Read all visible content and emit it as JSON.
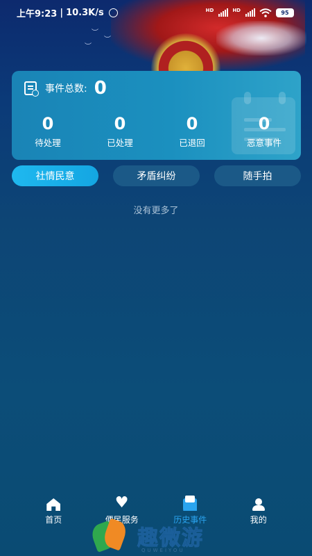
{
  "status_bar": {
    "time": "上午9:23",
    "separator": "|",
    "speed": "10.3K/s",
    "hd1": "HD",
    "hd2": "HD",
    "battery": "95"
  },
  "summary": {
    "total_label": "事件总数:",
    "total_value": "0",
    "stats": [
      {
        "value": "0",
        "label": "待处理"
      },
      {
        "value": "0",
        "label": "已处理"
      },
      {
        "value": "0",
        "label": "已退回"
      },
      {
        "value": "0",
        "label": "恶意事件"
      }
    ]
  },
  "tabs": [
    {
      "label": "社情民意",
      "active": true
    },
    {
      "label": "矛盾纠纷",
      "active": false
    },
    {
      "label": "随手拍",
      "active": false
    }
  ],
  "empty_text": "没有更多了",
  "bottom_nav": [
    {
      "label": "首页",
      "icon": "home-icon"
    },
    {
      "label": "便民服务",
      "icon": "heart-hand-icon"
    },
    {
      "label": "历史事件",
      "icon": "mail-icon",
      "active": true
    },
    {
      "label": "我的",
      "icon": "user-icon"
    }
  ],
  "watermark": {
    "text": "趣微游",
    "sub": "QUWEIYOU"
  },
  "colors": {
    "accent": "#2aa4ef",
    "card": "#1b90bf",
    "background": "#0c4d78"
  }
}
